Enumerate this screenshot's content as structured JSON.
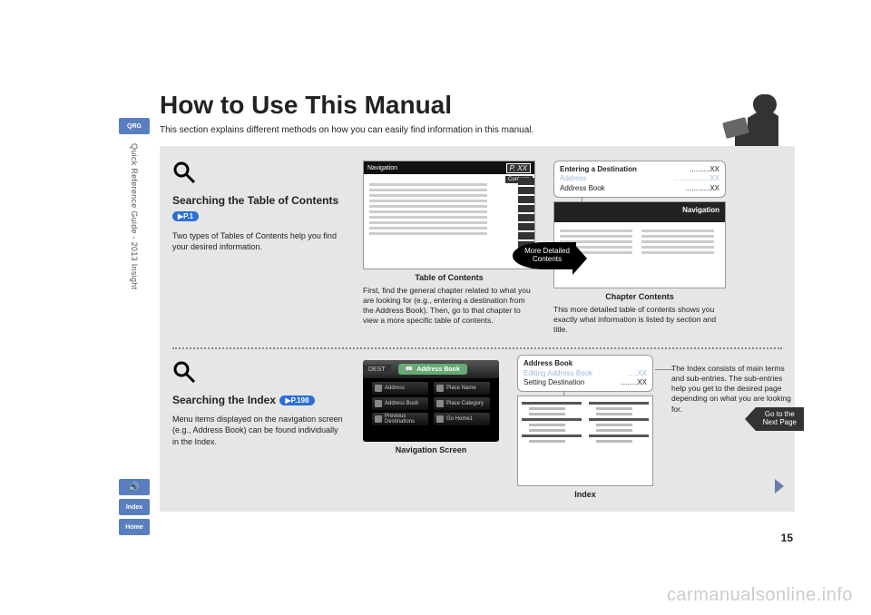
{
  "sidebar": {
    "qrg": "QRG",
    "vertical_label": "Quick Reference Guide - 2013 Insight",
    "voice": "🔊",
    "index": "Index",
    "home": "Home"
  },
  "title": "How to Use This Manual",
  "subtitle": "This section explains different methods on how you can easily find information in this manual.",
  "section1": {
    "heading": "Searching the Table of Contents",
    "pref": "▶P.1",
    "body": "Two types of Tables of Contents help you find your desired information.",
    "mid": {
      "nav_tab": "Navigation",
      "pxx": "P. XX",
      "contents_label": "Contents",
      "more_detailed": "More Detailed Contents",
      "caption": "Table of Contents",
      "desc": "First, find the general chapter related to what you are looking for (e.g., entering a destination from the Address Book). Then, go to that chapter to view a more specific table of contents."
    },
    "right": {
      "callout_title": "Entering a Destination",
      "callout_title_page": "XX",
      "row1_label": "Address",
      "row1_page": "XX",
      "row2_label": "Address Book",
      "row2_page": "XX",
      "nav_head": "Navigation",
      "caption": "Chapter Contents",
      "desc": "This more detailed table of contents shows you exactly what information is listed by section and title."
    }
  },
  "section2": {
    "heading": "Searching the Index",
    "pref": "▶P.198",
    "body": "Menu items displayed on the navigation screen (e.g., Address Book) can be found individually in the Index.",
    "navshot": {
      "tab": "DEST",
      "title_icon": "📖",
      "title": "Address Book",
      "items": [
        "Address",
        "Place Name",
        "Address Book",
        "Place Category",
        "Previous Destinations",
        "Go Home1"
      ],
      "caption": "Navigation Screen"
    },
    "callout": {
      "title": "Address Book",
      "row1_label": "Editing Address Book",
      "row1_page": "XX",
      "row2_label": "Setting Destination",
      "row2_page": "XX"
    },
    "index_caption": "Index",
    "right_desc": "The Index consists of main terms and sub-entries. The sub-entries help you get to the desired page depending on what you are looking for.",
    "goto": "Go to the\nNext Page"
  },
  "page_number": "15",
  "watermark": "carmanualsonline.info"
}
